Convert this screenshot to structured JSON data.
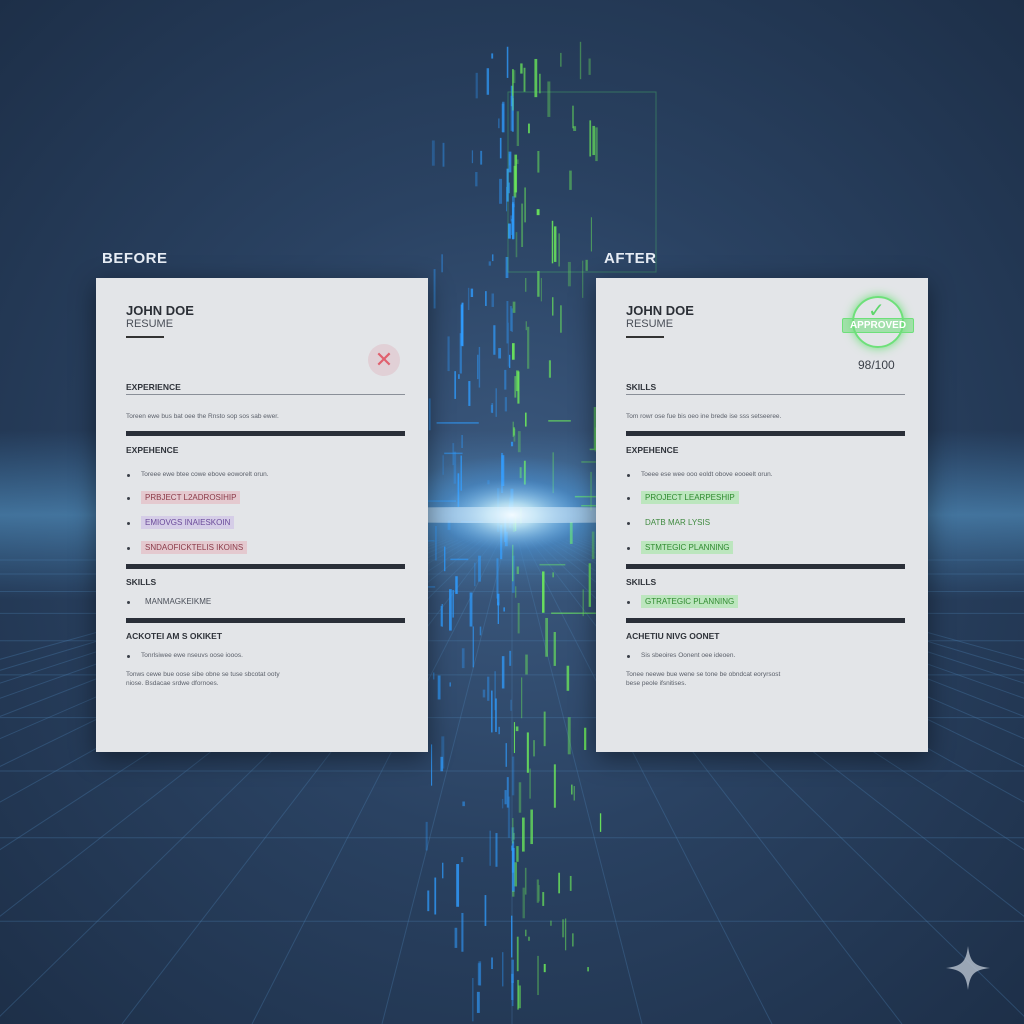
{
  "before": {
    "title": "BEFORE",
    "name": "JOHN DOE",
    "subtitle": "RESUME",
    "section1": "EXPERIENCE",
    "text1": "Toreen ewe bus bat oee the Rnsto sop sos sab ewer.",
    "section2": "EXPEHENCE",
    "bullets": [
      {
        "text": "Toreee ewe btee cowe ebove eoworelt orun.",
        "style": "plain"
      },
      {
        "text": "PRBJECT L2ADROSIHIP",
        "style": "red"
      },
      {
        "text": "EMIOVGS INAIESKOIN",
        "style": "purple"
      },
      {
        "text": "SNDAOFICKTELIS IKOINS",
        "style": "red"
      }
    ],
    "section3": "SKILLS",
    "skill": "MANMAGKEIKME",
    "section4": "ACKOTEI AM S OKIKET",
    "bullet4": "Tonrlsiwee ewe nseuvs oose iooos.",
    "text4": "Tonws cewe bue oose sibe obne se tuse sbcotat ooty niose. Bsdacae srdwe dfornoes."
  },
  "after": {
    "title": "AFTER",
    "name": "JOHN DOE",
    "subtitle": "RESUME",
    "stamp": "APPROVED",
    "score": "98/100",
    "section1": "SKILLS",
    "text1": "Tom rowr ose fue bis oeo ine brede ise sss setseeree.",
    "section2": "EXPEHENCE",
    "bullets": [
      {
        "text": "Toeee ese wee ooo eoldt obove eooeelt orun.",
        "style": "plain"
      },
      {
        "text": "PROJECT LEARPESHIP",
        "style": "green"
      },
      {
        "text": "DATB MAR LYSIS",
        "style": "green"
      },
      {
        "text": "STMTEGIC PLANNING",
        "style": "green"
      }
    ],
    "section3": "SKILLS",
    "skill": "GTRATEGIC PLANNING",
    "section4": "ACHETIU NIVG OONET",
    "bullet4": "Sis sbeoires Oonent oee ideoen.",
    "text4": "Tonee neewe bue wene se tone be obndcat eoryrsost bese peole ifsnitises."
  },
  "colors": {
    "left_glow": "#2f9cff",
    "right_glow": "#6ef05a",
    "before_mark": "#e0606e",
    "after_mark": "#6ee07a"
  }
}
